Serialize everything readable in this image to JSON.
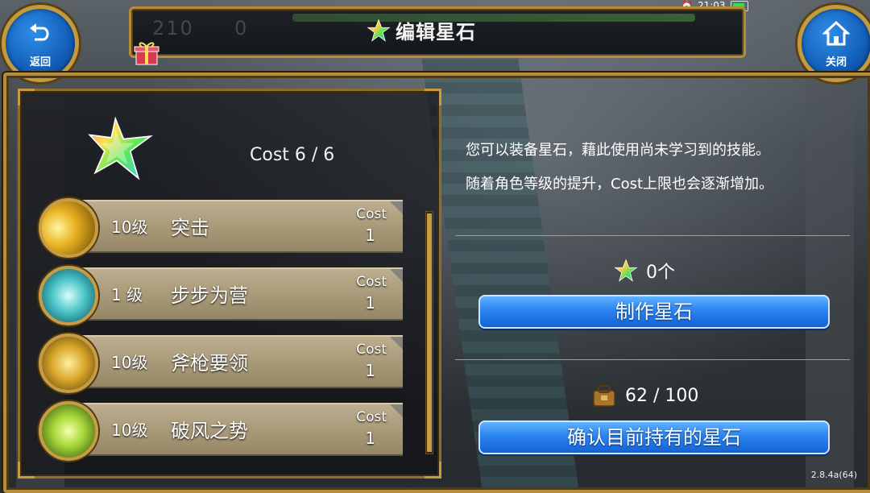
{
  "status_bar": {
    "time": "21:03"
  },
  "header": {
    "title": "编辑星石",
    "ghost_left": "210",
    "ghost_right": "0"
  },
  "nav": {
    "back_label": "返回",
    "close_label": "关闭"
  },
  "left_panel": {
    "cost_text": "Cost 6 / 6",
    "skills": [
      {
        "level": "10级",
        "name": "突击",
        "cost_label": "Cost",
        "cost": "1",
        "icon": "charge-icon"
      },
      {
        "level": "1 级",
        "name": "步步为营",
        "cost_label": "Cost",
        "cost": "1",
        "icon": "shield-stance-icon"
      },
      {
        "level": "10级",
        "name": "斧枪要领",
        "cost_label": "Cost",
        "cost": "1",
        "icon": "halberd-icon"
      },
      {
        "level": "10级",
        "name": "破风之势",
        "cost_label": "Cost",
        "cost": "1",
        "icon": "wind-break-icon"
      }
    ]
  },
  "right_panel": {
    "desc_line1": "您可以装备星石，藉此使用尚未学习到的技能。",
    "desc_line2": "随着角色等级的提升，Cost上限也会逐渐增加。",
    "star_count": "0个",
    "craft_button": "制作星石",
    "bag_count": "62 / 100",
    "confirm_button": "确认目前持有的星石"
  },
  "version": "2.8.4a(64)",
  "colors": {
    "frame_gold": "#b68c3d",
    "button_blue": "#2b84f0",
    "row_tan": "#a79877"
  }
}
